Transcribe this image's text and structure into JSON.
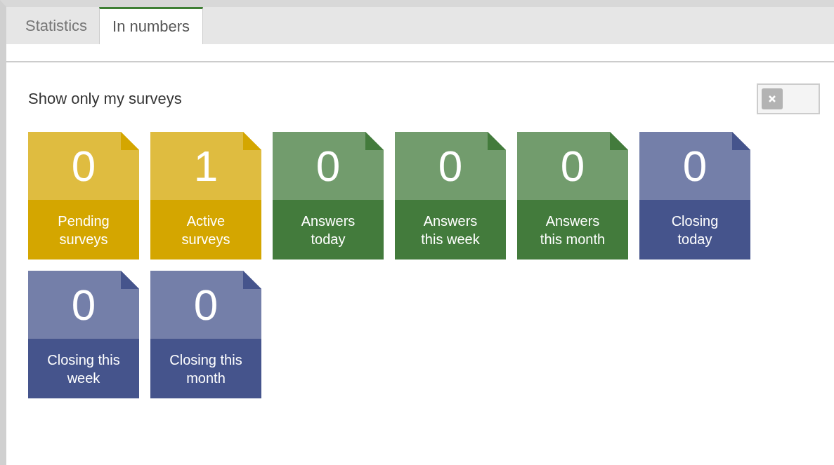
{
  "tabs": [
    {
      "label": "Statistics",
      "selected": false
    },
    {
      "label": "In numbers",
      "selected": true
    }
  ],
  "filter": {
    "label": "Show only my surveys",
    "on": false
  },
  "tiles": [
    {
      "value": "0",
      "label": "Pending surveys",
      "color": "#d4a600"
    },
    {
      "value": "1",
      "label": "Active surveys",
      "color": "#d4a600"
    },
    {
      "value": "0",
      "label": "Answers today",
      "color": "#437b3c"
    },
    {
      "value": "0",
      "label": "Answers this week",
      "color": "#437b3c"
    },
    {
      "value": "0",
      "label": "Answers this month",
      "color": "#437b3c"
    },
    {
      "value": "0",
      "label": "Closing today",
      "color": "#45548c"
    },
    {
      "value": "0",
      "label": "Closing this week",
      "color": "#45548c"
    },
    {
      "value": "0",
      "label": "Closing this month",
      "color": "#45548c"
    }
  ]
}
